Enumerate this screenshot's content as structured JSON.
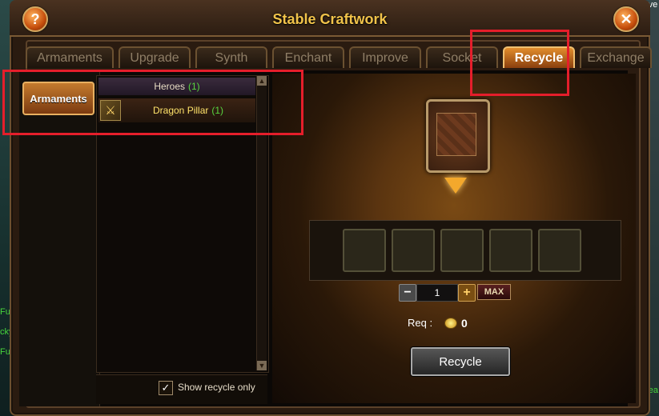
{
  "side_texts": [
    "Fur",
    "cky",
    "Fur"
  ],
  "side_text_right_top": "rve",
  "side_text_right_bottom": "brea",
  "window": {
    "title": "Stable Craftwork"
  },
  "help_icon": "?",
  "close_icon": "✕",
  "tabs": [
    "Armaments",
    "Upgrade",
    "Synth",
    "Enchant",
    "Improve",
    "Socket",
    "Recycle",
    "Exchange"
  ],
  "active_tab": "Recycle",
  "category": {
    "label": "Armaments"
  },
  "list": {
    "header": "Heroes",
    "header_count": "(1)",
    "items": [
      {
        "label": "Dragon Pillar",
        "count": "(1)",
        "icon": "sword-icon"
      }
    ]
  },
  "show_recycle_only": {
    "label": "Show recycle only",
    "checked": true,
    "check_glyph": "✓"
  },
  "quantity": {
    "minus": "−",
    "value": "1",
    "plus": "+",
    "max_label": "MAX"
  },
  "requirement": {
    "label": "Req :",
    "value": "0",
    "icon": "gold-coin-icon"
  },
  "recycle_button": "Recycle",
  "colors": {
    "highlight": "#e51e2b",
    "accent": "#f1c34a",
    "count_green": "#58d63f"
  }
}
